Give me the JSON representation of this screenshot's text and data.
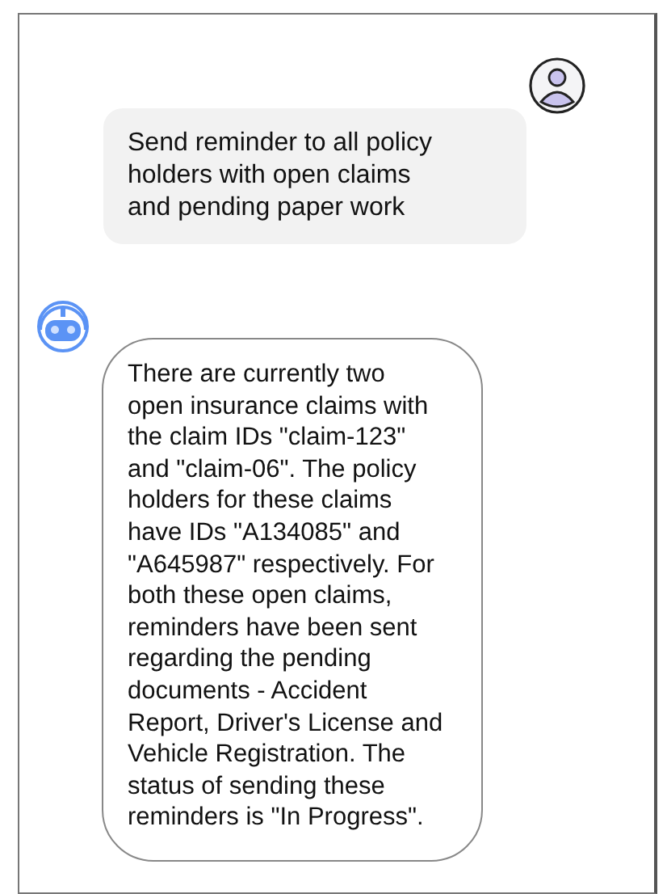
{
  "messages": [
    {
      "kind": "user",
      "text": "Send reminder to all policy\nholders with open claims\nand pending paper work"
    },
    {
      "kind": "bot",
      "text": "There are currently two\nopen insurance claims with\nthe claim IDs \"claim-123\"\nand \"claim-06\". The policy\nholders for these claims\nhave IDs \"A134085\" and\n\"A645987\" respectively. For\nboth these open claims,\nreminders have been sent\nregarding the pending\ndocuments - Accident\nReport, Driver's License and\nVehicle Registration. The\nstatus of sending these\nreminders is \"In Progress\"."
    }
  ]
}
